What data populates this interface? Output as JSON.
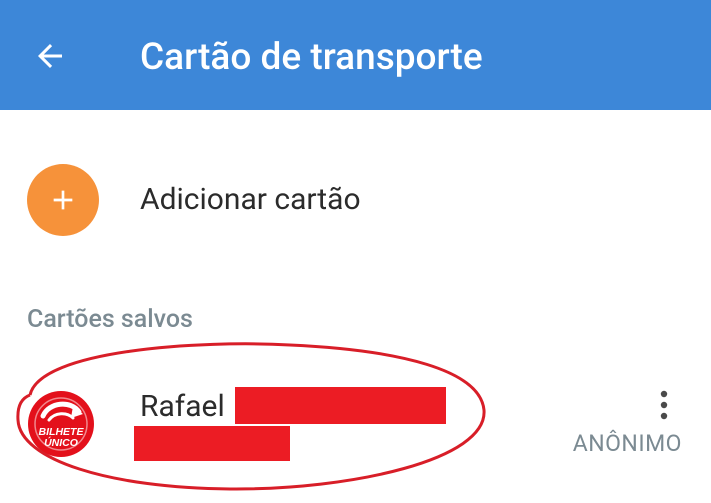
{
  "app_bar": {
    "title": "Cartão de transporte",
    "back_icon": "arrow-left-icon",
    "background_color": "#3d87d8"
  },
  "add_card": {
    "label": "Adicionar cartão",
    "icon": "plus-icon",
    "accent_color": "#f6923a"
  },
  "saved_cards": {
    "header": "Cartões salvos",
    "items": [
      {
        "name": "Rafael",
        "type": "ANÔNIMO",
        "logo_line1": "BILHETE",
        "logo_line2": "ÚNICO",
        "logo_color": "#e3101b",
        "menu_icon": "more-vertical-icon"
      }
    ]
  },
  "redaction_color": "#ec1c24",
  "annotation_color": "#d81e28"
}
